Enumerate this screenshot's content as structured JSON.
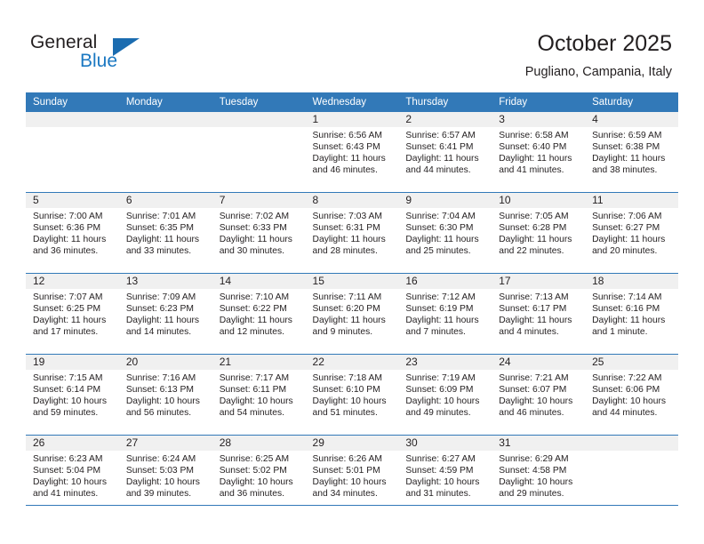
{
  "brand": {
    "name_top": "General",
    "name_bottom": "Blue",
    "color_dark": "#231f20",
    "color_blue": "#1b78c2"
  },
  "header": {
    "title": "October 2025",
    "subtitle": "Pugliano, Campania, Italy",
    "accent_color": "#3279b8"
  },
  "weekdays": [
    "Sunday",
    "Monday",
    "Tuesday",
    "Wednesday",
    "Thursday",
    "Friday",
    "Saturday"
  ],
  "weeks": [
    [
      {
        "day": "",
        "sunrise": "",
        "sunset": "",
        "daylight_1": "",
        "daylight_2": ""
      },
      {
        "day": "",
        "sunrise": "",
        "sunset": "",
        "daylight_1": "",
        "daylight_2": ""
      },
      {
        "day": "",
        "sunrise": "",
        "sunset": "",
        "daylight_1": "",
        "daylight_2": ""
      },
      {
        "day": "1",
        "sunrise": "Sunrise: 6:56 AM",
        "sunset": "Sunset: 6:43 PM",
        "daylight_1": "Daylight: 11 hours",
        "daylight_2": "and 46 minutes."
      },
      {
        "day": "2",
        "sunrise": "Sunrise: 6:57 AM",
        "sunset": "Sunset: 6:41 PM",
        "daylight_1": "Daylight: 11 hours",
        "daylight_2": "and 44 minutes."
      },
      {
        "day": "3",
        "sunrise": "Sunrise: 6:58 AM",
        "sunset": "Sunset: 6:40 PM",
        "daylight_1": "Daylight: 11 hours",
        "daylight_2": "and 41 minutes."
      },
      {
        "day": "4",
        "sunrise": "Sunrise: 6:59 AM",
        "sunset": "Sunset: 6:38 PM",
        "daylight_1": "Daylight: 11 hours",
        "daylight_2": "and 38 minutes."
      }
    ],
    [
      {
        "day": "5",
        "sunrise": "Sunrise: 7:00 AM",
        "sunset": "Sunset: 6:36 PM",
        "daylight_1": "Daylight: 11 hours",
        "daylight_2": "and 36 minutes."
      },
      {
        "day": "6",
        "sunrise": "Sunrise: 7:01 AM",
        "sunset": "Sunset: 6:35 PM",
        "daylight_1": "Daylight: 11 hours",
        "daylight_2": "and 33 minutes."
      },
      {
        "day": "7",
        "sunrise": "Sunrise: 7:02 AM",
        "sunset": "Sunset: 6:33 PM",
        "daylight_1": "Daylight: 11 hours",
        "daylight_2": "and 30 minutes."
      },
      {
        "day": "8",
        "sunrise": "Sunrise: 7:03 AM",
        "sunset": "Sunset: 6:31 PM",
        "daylight_1": "Daylight: 11 hours",
        "daylight_2": "and 28 minutes."
      },
      {
        "day": "9",
        "sunrise": "Sunrise: 7:04 AM",
        "sunset": "Sunset: 6:30 PM",
        "daylight_1": "Daylight: 11 hours",
        "daylight_2": "and 25 minutes."
      },
      {
        "day": "10",
        "sunrise": "Sunrise: 7:05 AM",
        "sunset": "Sunset: 6:28 PM",
        "daylight_1": "Daylight: 11 hours",
        "daylight_2": "and 22 minutes."
      },
      {
        "day": "11",
        "sunrise": "Sunrise: 7:06 AM",
        "sunset": "Sunset: 6:27 PM",
        "daylight_1": "Daylight: 11 hours",
        "daylight_2": "and 20 minutes."
      }
    ],
    [
      {
        "day": "12",
        "sunrise": "Sunrise: 7:07 AM",
        "sunset": "Sunset: 6:25 PM",
        "daylight_1": "Daylight: 11 hours",
        "daylight_2": "and 17 minutes."
      },
      {
        "day": "13",
        "sunrise": "Sunrise: 7:09 AM",
        "sunset": "Sunset: 6:23 PM",
        "daylight_1": "Daylight: 11 hours",
        "daylight_2": "and 14 minutes."
      },
      {
        "day": "14",
        "sunrise": "Sunrise: 7:10 AM",
        "sunset": "Sunset: 6:22 PM",
        "daylight_1": "Daylight: 11 hours",
        "daylight_2": "and 12 minutes."
      },
      {
        "day": "15",
        "sunrise": "Sunrise: 7:11 AM",
        "sunset": "Sunset: 6:20 PM",
        "daylight_1": "Daylight: 11 hours",
        "daylight_2": "and 9 minutes."
      },
      {
        "day": "16",
        "sunrise": "Sunrise: 7:12 AM",
        "sunset": "Sunset: 6:19 PM",
        "daylight_1": "Daylight: 11 hours",
        "daylight_2": "and 7 minutes."
      },
      {
        "day": "17",
        "sunrise": "Sunrise: 7:13 AM",
        "sunset": "Sunset: 6:17 PM",
        "daylight_1": "Daylight: 11 hours",
        "daylight_2": "and 4 minutes."
      },
      {
        "day": "18",
        "sunrise": "Sunrise: 7:14 AM",
        "sunset": "Sunset: 6:16 PM",
        "daylight_1": "Daylight: 11 hours",
        "daylight_2": "and 1 minute."
      }
    ],
    [
      {
        "day": "19",
        "sunrise": "Sunrise: 7:15 AM",
        "sunset": "Sunset: 6:14 PM",
        "daylight_1": "Daylight: 10 hours",
        "daylight_2": "and 59 minutes."
      },
      {
        "day": "20",
        "sunrise": "Sunrise: 7:16 AM",
        "sunset": "Sunset: 6:13 PM",
        "daylight_1": "Daylight: 10 hours",
        "daylight_2": "and 56 minutes."
      },
      {
        "day": "21",
        "sunrise": "Sunrise: 7:17 AM",
        "sunset": "Sunset: 6:11 PM",
        "daylight_1": "Daylight: 10 hours",
        "daylight_2": "and 54 minutes."
      },
      {
        "day": "22",
        "sunrise": "Sunrise: 7:18 AM",
        "sunset": "Sunset: 6:10 PM",
        "daylight_1": "Daylight: 10 hours",
        "daylight_2": "and 51 minutes."
      },
      {
        "day": "23",
        "sunrise": "Sunrise: 7:19 AM",
        "sunset": "Sunset: 6:09 PM",
        "daylight_1": "Daylight: 10 hours",
        "daylight_2": "and 49 minutes."
      },
      {
        "day": "24",
        "sunrise": "Sunrise: 7:21 AM",
        "sunset": "Sunset: 6:07 PM",
        "daylight_1": "Daylight: 10 hours",
        "daylight_2": "and 46 minutes."
      },
      {
        "day": "25",
        "sunrise": "Sunrise: 7:22 AM",
        "sunset": "Sunset: 6:06 PM",
        "daylight_1": "Daylight: 10 hours",
        "daylight_2": "and 44 minutes."
      }
    ],
    [
      {
        "day": "26",
        "sunrise": "Sunrise: 6:23 AM",
        "sunset": "Sunset: 5:04 PM",
        "daylight_1": "Daylight: 10 hours",
        "daylight_2": "and 41 minutes."
      },
      {
        "day": "27",
        "sunrise": "Sunrise: 6:24 AM",
        "sunset": "Sunset: 5:03 PM",
        "daylight_1": "Daylight: 10 hours",
        "daylight_2": "and 39 minutes."
      },
      {
        "day": "28",
        "sunrise": "Sunrise: 6:25 AM",
        "sunset": "Sunset: 5:02 PM",
        "daylight_1": "Daylight: 10 hours",
        "daylight_2": "and 36 minutes."
      },
      {
        "day": "29",
        "sunrise": "Sunrise: 6:26 AM",
        "sunset": "Sunset: 5:01 PM",
        "daylight_1": "Daylight: 10 hours",
        "daylight_2": "and 34 minutes."
      },
      {
        "day": "30",
        "sunrise": "Sunrise: 6:27 AM",
        "sunset": "Sunset: 4:59 PM",
        "daylight_1": "Daylight: 10 hours",
        "daylight_2": "and 31 minutes."
      },
      {
        "day": "31",
        "sunrise": "Sunrise: 6:29 AM",
        "sunset": "Sunset: 4:58 PM",
        "daylight_1": "Daylight: 10 hours",
        "daylight_2": "and 29 minutes."
      },
      {
        "day": "",
        "sunrise": "",
        "sunset": "",
        "daylight_1": "",
        "daylight_2": ""
      }
    ]
  ]
}
